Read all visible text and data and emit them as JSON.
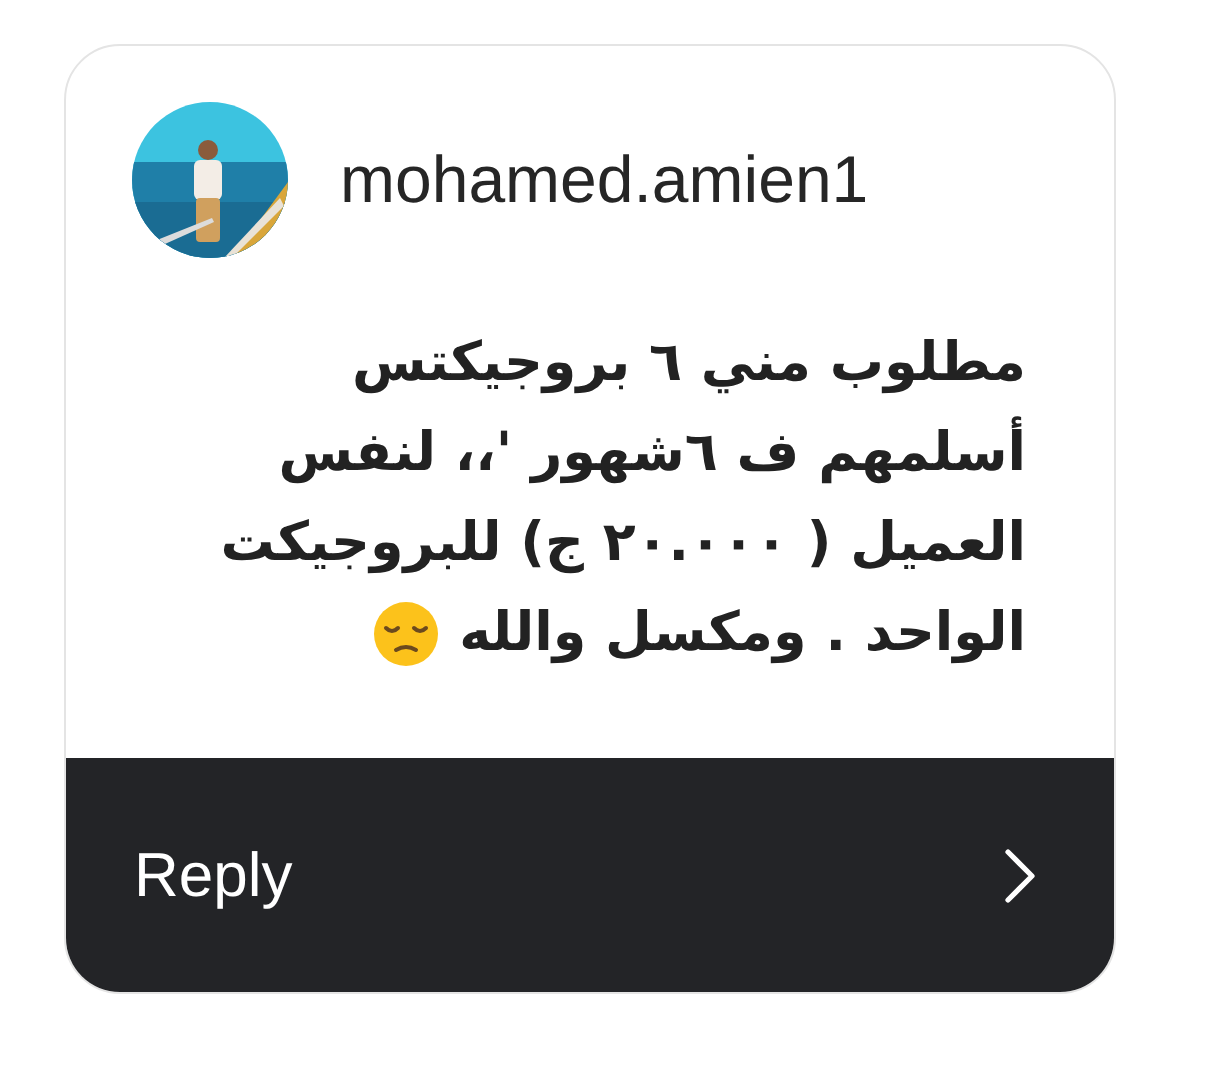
{
  "sender": {
    "username": "mohamed.amien1"
  },
  "message": {
    "lines": [
      "مطلوب مني ٦ بروجيكتس",
      "أسلمهم ف ٦شهور '،، لنفس",
      "العميل ( ٢٠.٠٠٠ ج) للبروجيكت",
      "الواحد . ومكسل والله"
    ]
  },
  "reply_bar": {
    "label": "Reply"
  }
}
